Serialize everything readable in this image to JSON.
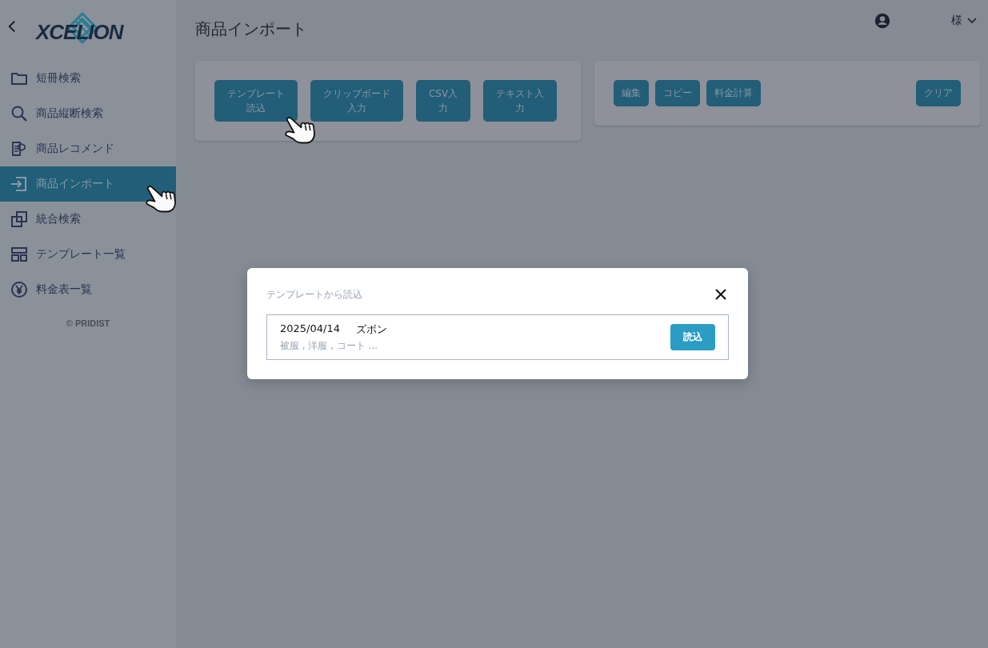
{
  "sidebar": {
    "logo": "XCELION",
    "items": [
      {
        "label": "短冊検索",
        "selected": false
      },
      {
        "label": "商品縦断検索",
        "selected": false
      },
      {
        "label": "商品レコメンド",
        "selected": false
      },
      {
        "label": "商品インポート",
        "selected": true
      },
      {
        "label": "統合検索",
        "selected": false
      },
      {
        "label": "テンプレート一覧",
        "selected": false
      },
      {
        "label": "料金表一覧",
        "selected": false
      }
    ],
    "footer": "© PRIDIST"
  },
  "header": {
    "title": "商品インポート",
    "user_suffix": "様"
  },
  "import_panel": {
    "buttons": [
      "テンプレート読込",
      "クリップボード入力",
      "CSV入力",
      "テキスト入力"
    ]
  },
  "action_panel": {
    "buttons": [
      "編集",
      "コピー",
      "料金計算"
    ],
    "clear_button": "クリア"
  },
  "modal": {
    "title": "テンプレートから読込",
    "templates": [
      {
        "date": "2025/04/14",
        "name": "ズボン",
        "tags": "被服 , 洋服 , コート ...",
        "button": "読込"
      }
    ]
  }
}
